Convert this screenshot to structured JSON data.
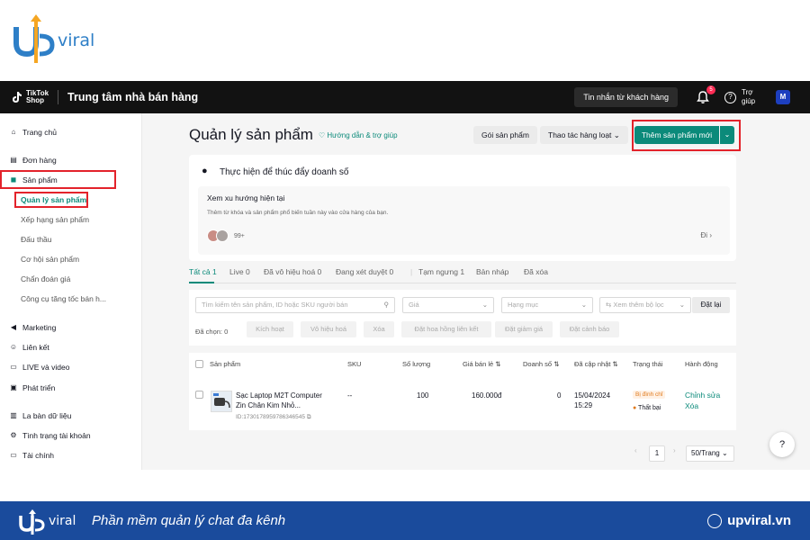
{
  "brand": {
    "top_logo_text": "viral",
    "bottom_logo_text": "viral",
    "slogan": "Phần mềm quản lý chat đa kênh",
    "website": "upviral.vn"
  },
  "header": {
    "tiktok_line1": "TikTok",
    "tiktok_line2": "Shop",
    "title": "Trung tâm nhà bán hàng",
    "messages_button": "Tin nhắn từ khách hàng",
    "notification_count": "5",
    "help_label": "Trợ giúp"
  },
  "sidebar": {
    "home": "Trang chủ",
    "orders": "Đơn hàng",
    "products": "Sản phẩm",
    "product_subitems": [
      "Quản lý sản phẩm",
      "Xếp hạng sản phẩm",
      "Đấu thầu",
      "Cơ hội sản phẩm",
      "Chẩn đoán giá",
      "Công cụ tăng tốc bán h..."
    ],
    "marketing": "Marketing",
    "affiliate": "Liên kết",
    "live_video": "LIVE và video",
    "growth": "Phát triển",
    "compass": "La bàn dữ liệu",
    "account_health": "Tình trạng tài khoản",
    "finance": "Tài chính"
  },
  "main": {
    "title": "Quản lý sản phẩm",
    "guide_link": "Hướng dẫn & trợ giúp",
    "package_button": "Gói sản phẩm",
    "bulk_button": "Thao tác hàng loạt",
    "add_button": "Thêm sản phẩm mới",
    "promo": {
      "title": "Thực hiện để thúc đẩy doanh số",
      "card_title": "Xem xu hướng hiện tại",
      "card_desc": "Thêm từ khóa và sản phẩm phổ biến tuần này vào cửa hàng của bạn.",
      "count": "99+",
      "go": "Đi"
    },
    "tabs": [
      {
        "label": "Tất cả 1"
      },
      {
        "label": "Live 0"
      },
      {
        "label": "Đã vô hiệu hoá 0"
      },
      {
        "label": "Đang xét duyệt 0"
      },
      {
        "label": "Tạm ngưng 1"
      },
      {
        "label": "Bản nháp"
      },
      {
        "label": "Đã xóa"
      }
    ],
    "filters": {
      "search_placeholder": "Tìm kiếm tên sản phẩm, ID hoặc SKU người bán",
      "price_placeholder": "Giá",
      "category_placeholder": "Hạng mục",
      "more_filters": "Xem thêm bộ lọc",
      "reset": "Đặt lại",
      "selected_label": "Đã chọn: 0",
      "actions": [
        "Kích hoạt",
        "Vô hiệu hoá",
        "Xóa",
        "Đặt hoa hồng liên kết",
        "Đặt giảm giá",
        "Đặt cảnh báo"
      ]
    },
    "table": {
      "headers": [
        "Sản phẩm",
        "SKU",
        "Số lượng",
        "Giá bán lẻ",
        "Doanh số",
        "Đã cập nhật",
        "Trạng thái",
        "Hành động"
      ],
      "rows": [
        {
          "name_line1": "Sạc Laptop M2T Computer",
          "name_line2": "Zin Chân Kim Nhỏ...",
          "id": "ID:1730178959786346545",
          "sku": "--",
          "quantity": "100",
          "price": "160.000đ",
          "sales": "0",
          "updated_date": "15/04/2024",
          "updated_time": "15:29",
          "status": "Bị đình chỉ",
          "status_sub": "Thất bại",
          "action_edit": "Chỉnh sửa",
          "action_delete": "Xóa"
        }
      ]
    },
    "pagination": {
      "page": "1",
      "page_size": "50/Trang"
    }
  }
}
